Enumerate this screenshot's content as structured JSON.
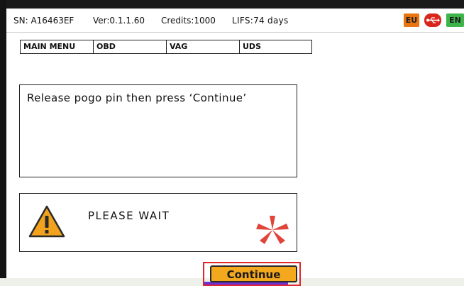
{
  "status_bar": {
    "serial": "SN: A16463EF",
    "version": "Ver:0.1.1.60",
    "credits": "Credits:1000",
    "lifs": "LIFS:74 days",
    "region_flag": "EU",
    "connection_icon": "usb-icon",
    "language_flag": "EN",
    "colors": {
      "eu": "#e8750e",
      "usb": "#d9261c",
      "en": "#3db54a"
    }
  },
  "breadcrumb": [
    "MAIN MENU",
    "OBD",
    "VAG",
    "UDS"
  ],
  "message": "Release pogo pin then press ‘Continue’",
  "wait": {
    "text": "PLEASE WAIT",
    "warning_icon": "warning-triangle-icon",
    "spinner_icon": "spinner-icon",
    "colors": {
      "warning": "#f2a21c",
      "spinner": "#e0453a"
    }
  },
  "continue_button": {
    "label": "Continue",
    "color": "#f4a81e"
  }
}
